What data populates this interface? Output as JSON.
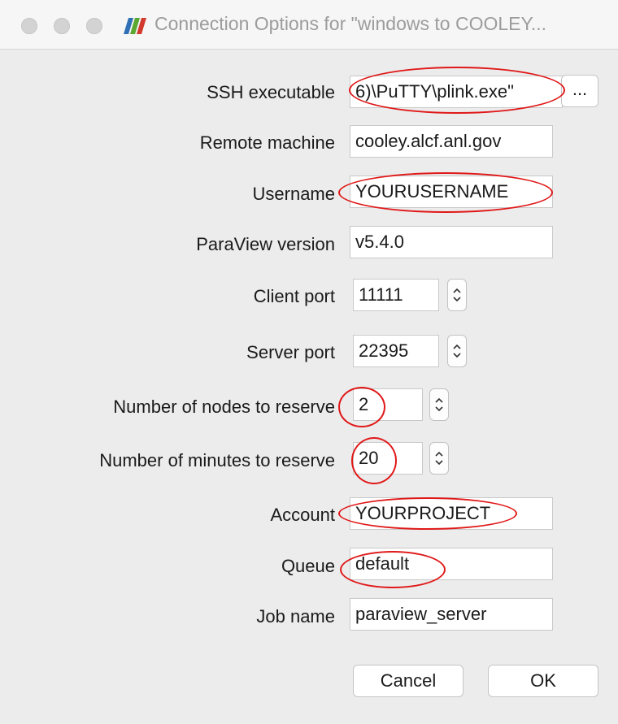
{
  "window": {
    "title": "Connection Options for \"windows to COOLEY..."
  },
  "form": {
    "ssh_executable": {
      "label": "SSH executable",
      "value": "6)\\PuTTY\\plink.exe\"",
      "browse_label": "..."
    },
    "remote_machine": {
      "label": "Remote machine",
      "value": "cooley.alcf.anl.gov"
    },
    "username": {
      "label": "Username",
      "value": "YOURUSERNAME"
    },
    "paraview_version": {
      "label": "ParaView version",
      "value": "v5.4.0"
    },
    "client_port": {
      "label": "Client port",
      "value": "11111"
    },
    "server_port": {
      "label": "Server port",
      "value": "22395"
    },
    "nodes": {
      "label": "Number of nodes to reserve",
      "value": "2"
    },
    "minutes": {
      "label": "Number of minutes to reserve",
      "value": "20"
    },
    "account": {
      "label": "Account",
      "value": "YOURPROJECT"
    },
    "queue": {
      "label": "Queue",
      "value": "default"
    },
    "job_name": {
      "label": "Job name",
      "value": "paraview_server"
    }
  },
  "buttons": {
    "cancel": "Cancel",
    "ok": "OK"
  },
  "annotations": {
    "color": "#e01818"
  }
}
